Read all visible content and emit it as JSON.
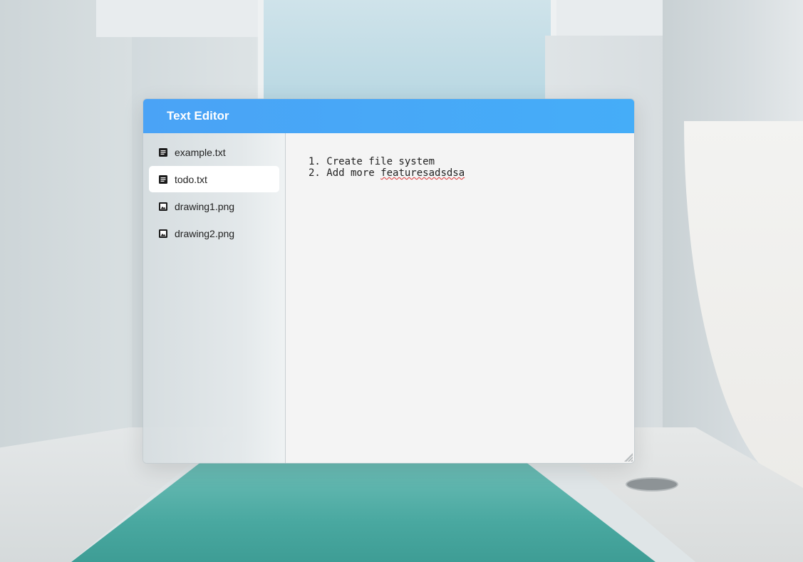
{
  "app": {
    "title": "Text Editor"
  },
  "sidebar": {
    "files": [
      {
        "name": "example.txt",
        "icon": "text-file-icon"
      },
      {
        "name": "todo.txt",
        "icon": "text-file-icon",
        "selected": true
      },
      {
        "name": "drawing1.png",
        "icon": "image-file-icon"
      },
      {
        "name": "drawing2.png",
        "icon": "image-file-icon"
      }
    ]
  },
  "editor": {
    "line1": "1. Create file system",
    "line2_prefix": "2. Add more ",
    "line2_misspelled": "featuresadsdsa"
  },
  "colors": {
    "titlebar": "#4aa3f6",
    "selected_item": "#ffffff",
    "editor_bg": "#f4f4f4"
  }
}
